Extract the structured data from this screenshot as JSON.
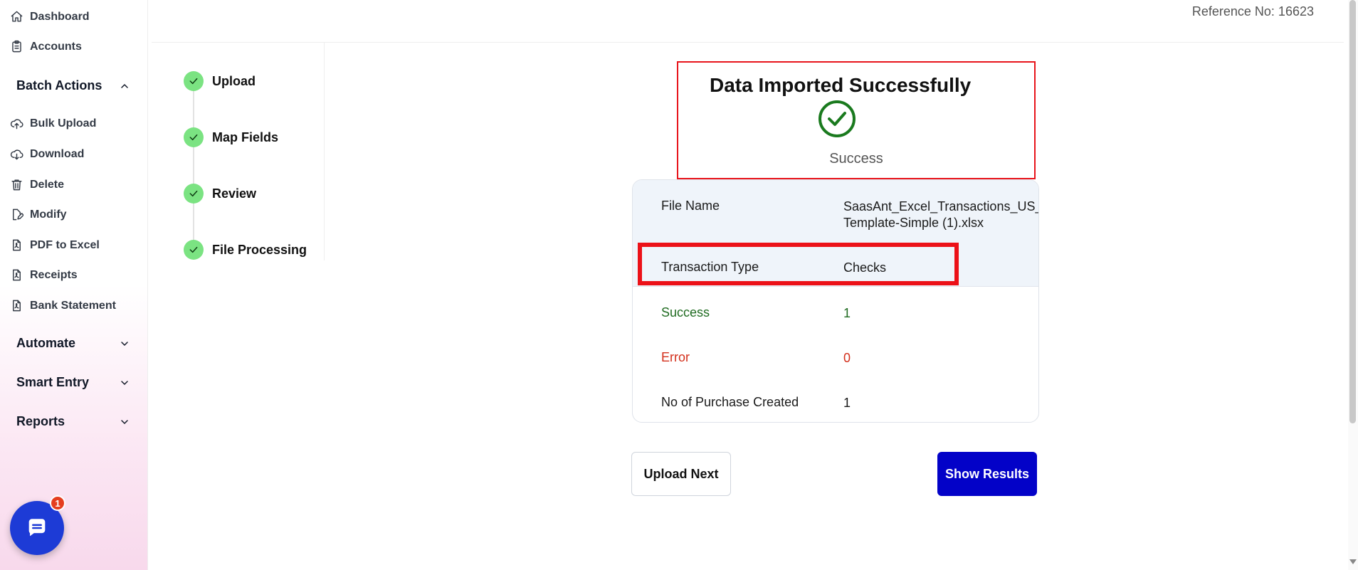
{
  "sidebar": {
    "top_items": [
      {
        "label": "Dashboard",
        "icon": "home-icon"
      },
      {
        "label": "Accounts",
        "icon": "clipboard-icon"
      }
    ],
    "batch_actions": {
      "label": "Batch Actions",
      "expanded": true,
      "items": [
        {
          "label": "Bulk Upload",
          "icon": "cloud-upload-icon"
        },
        {
          "label": "Download",
          "icon": "cloud-download-icon"
        },
        {
          "label": "Delete",
          "icon": "trash-icon"
        },
        {
          "label": "Modify",
          "icon": "edit-file-icon"
        },
        {
          "label": "PDF to Excel",
          "icon": "pdf-file-icon"
        },
        {
          "label": "Receipts",
          "icon": "pdf-file-icon"
        },
        {
          "label": "Bank Statement",
          "icon": "pdf-file-icon"
        }
      ]
    },
    "groups": [
      {
        "label": "Automate"
      },
      {
        "label": "Smart Entry"
      },
      {
        "label": "Reports"
      }
    ],
    "chat": {
      "badge": "1",
      "icon": "chat-icon",
      "color": "#1d3bd6"
    }
  },
  "header": {
    "reference": "Reference No: 16623"
  },
  "stepper": {
    "steps": [
      {
        "label": "Upload",
        "status": "complete"
      },
      {
        "label": "Map Fields",
        "status": "complete"
      },
      {
        "label": "Review",
        "status": "complete"
      },
      {
        "label": "File Processing",
        "status": "complete"
      }
    ],
    "complete_color": "#7be382"
  },
  "result": {
    "title": "Data Imported Successfully",
    "status": "Success",
    "icon": "check-circle-icon",
    "success_color": "#1a7a1e"
  },
  "details": {
    "file_name_label": "File Name",
    "file_name_line1": "SaasAnt_Excel_Transactions_US_",
    "file_name_line2": "Template-Simple (1).xlsx",
    "transaction_type_label": "Transaction Type",
    "transaction_type_value": "Checks",
    "success_label": "Success",
    "success_value": "1",
    "error_label": "Error",
    "error_value": "0",
    "purchase_label": "No of Purchase Created",
    "purchase_value": "1"
  },
  "actions": {
    "upload_next": "Upload Next",
    "show_results": "Show Results",
    "primary_color": "#0302c8"
  }
}
